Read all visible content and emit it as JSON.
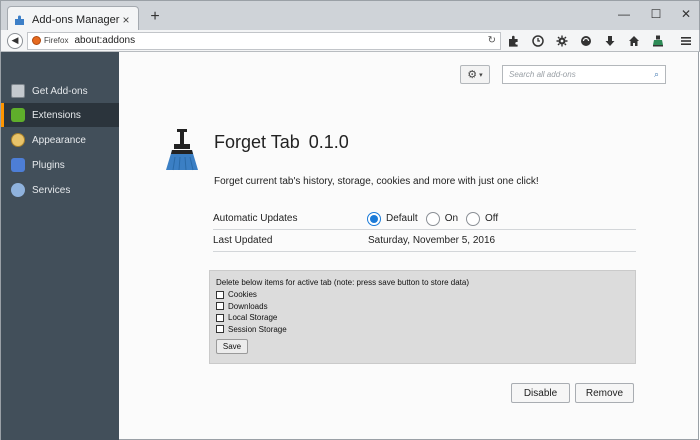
{
  "window": {
    "tab_title": "Add-ons Manager",
    "tab_close": "×",
    "new_tab": "+",
    "minimize": "—",
    "maximize": "☐",
    "close": "✕"
  },
  "navbar": {
    "identity_label": "Firefox",
    "url": "about:addons",
    "toolbar_icons": [
      "puzzle-icon",
      "history-icon",
      "settings-icon",
      "sync-icon",
      "download-icon",
      "home-icon",
      "addon-icon",
      "menu-icon"
    ]
  },
  "sidebar": {
    "items": [
      {
        "label": "Get Add-ons",
        "icon": "get-addons-icon",
        "selected": false
      },
      {
        "label": "Extensions",
        "icon": "extensions-icon",
        "selected": true
      },
      {
        "label": "Appearance",
        "icon": "appearance-icon",
        "selected": false
      },
      {
        "label": "Plugins",
        "icon": "plugins-icon",
        "selected": false
      },
      {
        "label": "Services",
        "icon": "services-icon",
        "selected": false
      }
    ],
    "accent": "#ff9500"
  },
  "search": {
    "placeholder": "Search all add-ons"
  },
  "addon": {
    "name": "Forget Tab",
    "version": "0.1.0",
    "description": "Forget current tab's history, storage, cookies and more with just one click!"
  },
  "details": {
    "auto_updates_label": "Automatic Updates",
    "auto_updates_options": [
      "Default",
      "On",
      "Off"
    ],
    "auto_updates_selected": "Default",
    "last_updated_label": "Last Updated",
    "last_updated_value": "Saturday, November 5, 2016"
  },
  "prefs": {
    "heading": "Delete below items for active tab (note: press save button to store data)",
    "options": [
      "Cookies",
      "Downloads",
      "Local Storage",
      "Session Storage"
    ],
    "save_label": "Save"
  },
  "actions": {
    "disable_label": "Disable",
    "remove_label": "Remove"
  }
}
